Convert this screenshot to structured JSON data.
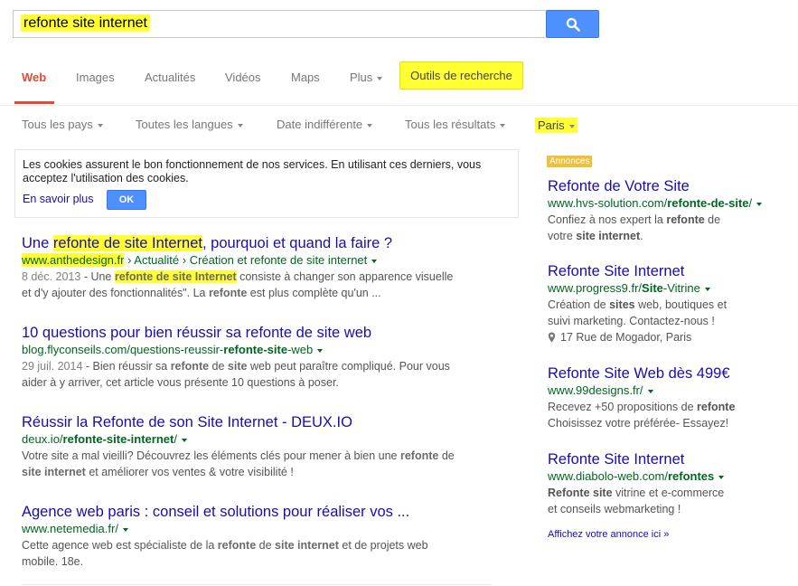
{
  "search": {
    "query": "refonte site internet"
  },
  "tabs": [
    {
      "label": "Web",
      "active": true
    },
    {
      "label": "Images"
    },
    {
      "label": "Actualités"
    },
    {
      "label": "Vidéos"
    },
    {
      "label": "Maps"
    },
    {
      "label": "Plus"
    }
  ],
  "tools_label": "Outils de recherche",
  "filters": [
    "Tous les pays",
    "Toutes les langues",
    "Date indifférente",
    "Tous les résultats",
    "Paris"
  ],
  "cookie": {
    "text": "Les cookies assurent le bon fonctionnement de nos services. En utilisant ces derniers, vous acceptez l'utilisation des cookies.",
    "more": "En savoir plus",
    "ok": "OK"
  },
  "results": [
    {
      "title_a": "Une ",
      "title_hl": "refonte de site Internet",
      "title_b": ", pourquoi et quand la faire ?",
      "url_hl": "www.anthedesign.fr",
      "url_rest": " › Actualité › Création et refonte de site internet",
      "date": "8 déc. 2013",
      "snip_1": " - Une ",
      "snip_hl": "refonte de site Internet",
      "snip_2": " consiste à changer son apparence visuelle",
      "snip_3": "et d'y ajouter des fonctionnalités\". La ",
      "snip_b1": "refonte",
      "snip_4": " est plus complète qu'un ..."
    },
    {
      "title": "10 questions pour bien réussir sa refonte de site web",
      "url_a": "blog.flyconseils.com/questions-reussir-",
      "url_b": "refonte-site",
      "url_c": "-web",
      "date": "29 juil. 2014",
      "snip_1": " - Bien réussir sa ",
      "snip_b1": "refonte",
      "snip_2": " de ",
      "snip_b2": "site",
      "snip_3": " web peut paraître compliqué. Pour vous",
      "snip_4": "aider à y arriver, cet article vous présente 10 questions à poser."
    },
    {
      "title": "Réussir la Refonte de son Site Internet - DEUX.IO",
      "url_a": "deux.io/",
      "url_b": "refonte-site-internet",
      "url_c": "/",
      "snip_1": "Votre site a mal vieilli? Découvrez les éléments clés pour mener à bien une ",
      "snip_b1": "refonte",
      "snip_2": " de",
      "snip_b2": "site internet",
      "snip_3": " et améliorer vos ventes & votre visibilité !"
    },
    {
      "title": "Agence web paris : conseil et solutions pour réaliser vos ...",
      "url_a": "www.netemedia.fr/",
      "snip_1": "Cette agence web est spécialiste de la ",
      "snip_b1": "refonte",
      "snip_2": " de ",
      "snip_b2": "site internet",
      "snip_3": " et de projets web",
      "snip_4": "mobile. 18e."
    }
  ],
  "ads": {
    "label": "Annonces",
    "items": [
      {
        "title": "Refonte de Votre Site",
        "url_a": "www.hvs-solution.com/",
        "url_b": "refonte-de-site",
        "url_c": "/",
        "l1_a": "Confiez à nos expert la ",
        "l1_b": "refonte",
        "l1_c": " de",
        "l2_a": "votre ",
        "l2_b": "site internet",
        "l2_c": "."
      },
      {
        "title": "Refonte Site Internet",
        "url_a": "www.progress9.fr/",
        "url_b": "Site",
        "url_c": "-Vitrine",
        "l1_a": "Création de ",
        "l1_b": "sites",
        "l1_c": " web, boutiques et",
        "l2_a": "suivi marketing. Contactez-nous !",
        "l2_b": "",
        "l2_c": "",
        "address": "17 Rue de Mogador, Paris"
      },
      {
        "title": "Refonte Site Web dès 499€",
        "url_a": "www.99designs.fr/",
        "url_b": "",
        "url_c": "",
        "l1_a": "Recevez +50 propositions de ",
        "l1_b": "refonte",
        "l1_c": "",
        "l2_a": "Choisissez votre préférée- Essayez!",
        "l2_b": "",
        "l2_c": ""
      },
      {
        "title": "Refonte Site Internet",
        "url_a": "www.diabolo-web.com/",
        "url_b": "refontes",
        "url_c": "",
        "l1_a": "",
        "l1_b": "Refonte site",
        "l1_c": " vitrine et e-commerce",
        "l2_a": "et conseils webmarketing !",
        "l2_b": "",
        "l2_c": ""
      }
    ],
    "more": "Affichez votre annonce ici »"
  },
  "colors": {
    "highlight": "#ffff33",
    "link": "#1a0dab",
    "url": "#006621",
    "accent": "#dd4b39",
    "button": "#4d90fe",
    "ads_label": "#f0c03b"
  }
}
